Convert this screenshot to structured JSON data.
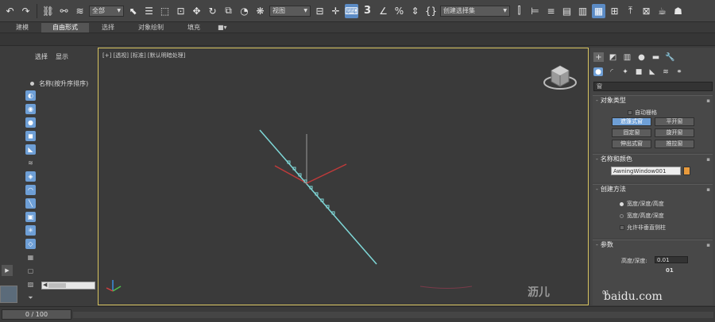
{
  "toolbar": {
    "filter_dropdown": "全部",
    "view_dropdown": "视图",
    "snap_3": "3",
    "selection_set_placeholder": "创建选择集"
  },
  "ribbon": {
    "tabs": [
      "建模",
      "自由形式",
      "选择",
      "对象绘制",
      "填充"
    ]
  },
  "scene_explorer": {
    "tabs": [
      "选择",
      "显示"
    ],
    "column_header": "名称(按升序排序)"
  },
  "viewport": {
    "label": "[+] [透视] [标准] [默认明暗处理]",
    "watermark_text": "沥儿"
  },
  "command_panel": {
    "type_dropdown": "窗",
    "object_type": {
      "title": "对象类型",
      "autogrid": "自动栅格",
      "buttons": [
        "遮篷式窗",
        "平开窗",
        "固定窗",
        "旋开窗",
        "伸出式窗",
        "推拉窗"
      ]
    },
    "name_color": {
      "title": "名称和颜色",
      "name_value": "AwningWindow001",
      "color": "#e89a3c"
    },
    "creation_method": {
      "title": "创建方法",
      "options": [
        "宽度/深度/高度",
        "宽度/高度/深度"
      ],
      "non_vertical": "允许非垂直侧柱"
    },
    "parameters": {
      "title": "参数",
      "height_depth_label": "高度/深度:",
      "height_depth_value": "0.01",
      "value_2": "01",
      "value_3": "01"
    }
  },
  "timeline": {
    "frame": "0 / 100"
  },
  "watermark": {
    "text": "baidu.com"
  }
}
